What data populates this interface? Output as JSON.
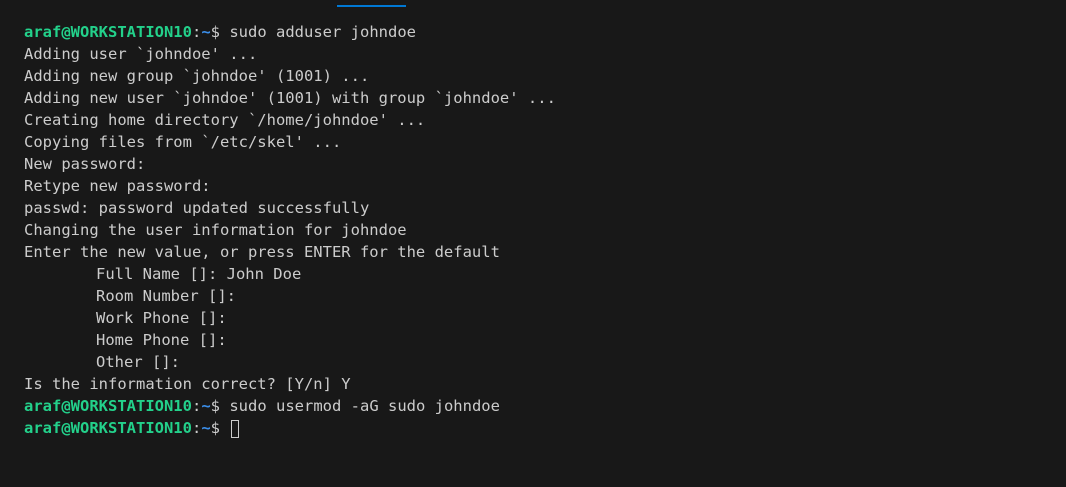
{
  "prompt": {
    "user_host": "araf@WORKSTATION10",
    "colon": ":",
    "path": "~",
    "dollar": "$"
  },
  "commands": {
    "adduser": " sudo adduser johndoe",
    "usermod": " sudo usermod -aG sudo johndoe",
    "current": " "
  },
  "output": [
    "Adding user `johndoe' ...",
    "Adding new group `johndoe' (1001) ...",
    "Adding new user `johndoe' (1001) with group `johndoe' ...",
    "Creating home directory `/home/johndoe' ...",
    "Copying files from `/etc/skel' ...",
    "New password:",
    "Retype new password:",
    "passwd: password updated successfully",
    "Changing the user information for johndoe",
    "Enter the new value, or press ENTER for the default"
  ],
  "user_info_fields": [
    "Full Name []: John Doe",
    "Room Number []:",
    "Work Phone []:",
    "Home Phone []:",
    "Other []:"
  ],
  "confirm": "Is the information correct? [Y/n] Y",
  "colors": {
    "background": "#181818",
    "text": "#cccccc",
    "prompt_user": "#23d18b",
    "prompt_path": "#3b8eea",
    "tab_indicator": "#0078d4"
  }
}
